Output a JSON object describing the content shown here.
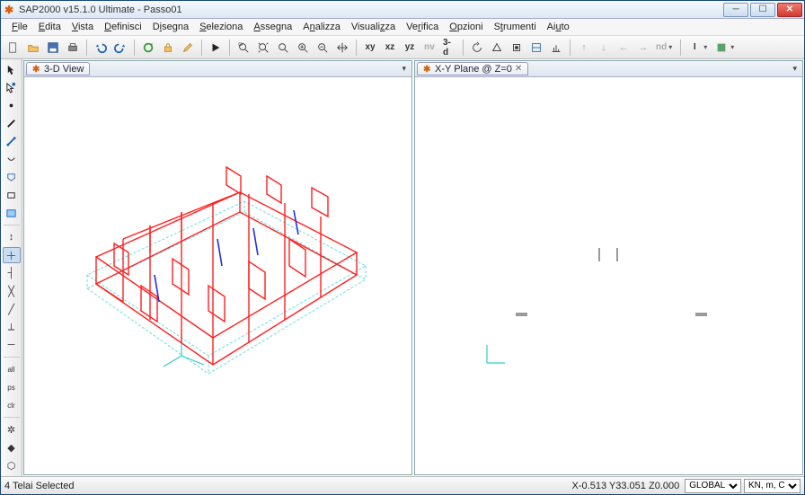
{
  "app_title": "SAP2000 v15.1.0 Ultimate  - Passo01",
  "menus": [
    "File",
    "Edita",
    "Vista",
    "Definisci",
    "Disegna",
    "Seleziona",
    "Assegna",
    "Analizza",
    "Visualizza",
    "Verifica",
    "Opzioni",
    "Strumenti",
    "Aiuto"
  ],
  "toolbar_text": {
    "xy": "xy",
    "xz": "xz",
    "yz": "yz",
    "nv": "nv",
    "threeD": "3-d",
    "nd": "nd",
    "I": "I"
  },
  "panes": {
    "left": {
      "tab": "3-D View"
    },
    "right": {
      "tab": "X-Y Plane @ Z=0"
    }
  },
  "status": {
    "selection": "4 Telai Selected",
    "coords": "X-0.513  Y33.051  Z0.000",
    "coord_system_options": [
      "GLOBAL"
    ],
    "coord_system": "GLOBAL",
    "units_options": [
      "KN, m, C"
    ],
    "units": "KN, m, C"
  }
}
